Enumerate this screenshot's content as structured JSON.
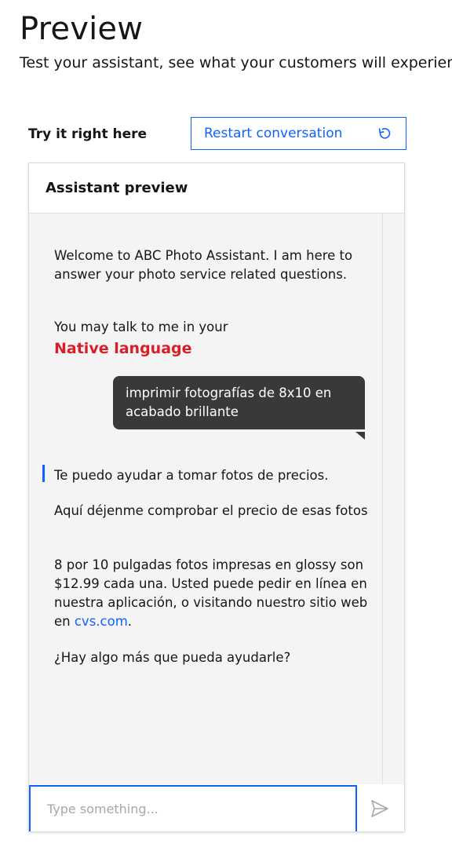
{
  "header": {
    "title": "Preview",
    "subtitle": "Test your assistant, see what your customers will experien"
  },
  "toolbar": {
    "try_label": "Try it right here",
    "restart_label": "Restart conversation",
    "restart_icon": "restart-icon"
  },
  "panel": {
    "title": "Assistant preview"
  },
  "conversation": {
    "welcome": "Welcome to ABC Photo Assistant. I am here to answer your photo service related questions.",
    "talk_prefix": "You may talk to me in your",
    "native_language": "Native language",
    "user_message": "imprimir fotografías de 8x10 en acabado brillante",
    "reply_1": "Te puedo ayudar a tomar fotos de precios.",
    "reply_2": "Aquí déjenme comprobar el precio de esas fotos",
    "reply_3_text": "8 por 10 pulgadas fotos impresas en glossy son $12.99 cada una. Usted puede pedir en línea en nuestra aplicación, o visitando nuestro sitio web en ",
    "reply_3_link": "cvs.com",
    "reply_3_end": ".",
    "reply_4": "¿Hay algo más que pueda ayudarle?"
  },
  "input": {
    "placeholder": "Type something...",
    "value": "",
    "send_icon": "send-icon"
  },
  "colors": {
    "accent": "#0f62fe",
    "highlight_red": "#da1e28",
    "user_bubble": "#393939",
    "chat_background": "#f4f4f4"
  }
}
